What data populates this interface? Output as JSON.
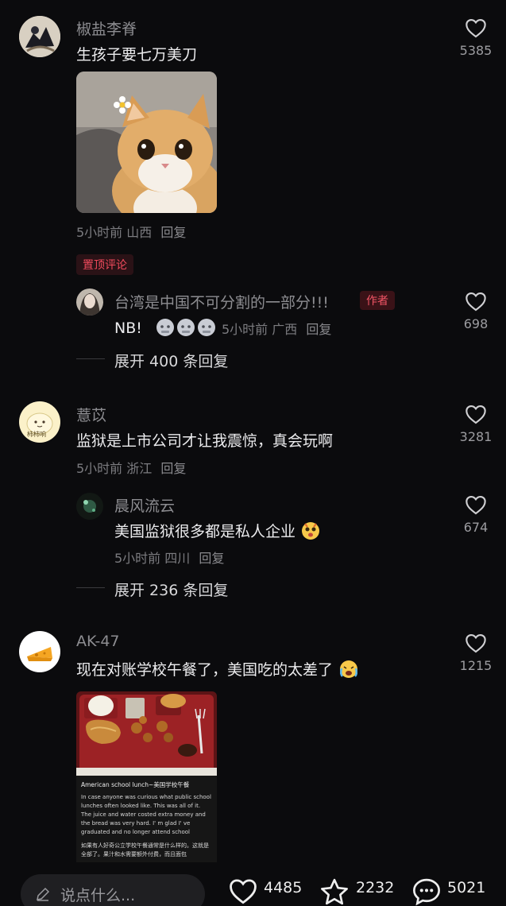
{
  "comments": [
    {
      "username": "椒盐李脊",
      "text": "生孩子要七万美刀",
      "time": "5小时前",
      "region": "山西",
      "reply_label": "回复",
      "likes": "5385"
    },
    {
      "username": "薏苡",
      "avatar_text": "柿柿响",
      "text": "监狱是上市公司才让我震惊，真会玩啊",
      "time": "5小时前",
      "region": "浙江",
      "reply_label": "回复",
      "likes": "3281"
    },
    {
      "username": "AK-47",
      "text": "现在对账学校午餐了，美国吃的太差了",
      "likes": "1215",
      "image": {
        "title": "American school lunch~美国学校午餐",
        "en_text": "In case anyone was curious what public school lunches often looked like. This was all of it. The juice and water costed extra money and the bread was very hard. I' m glad I' ve graduated and no longer attend school",
        "zh_text": "如果有人好奇公立学校午餐通常是什么样的。这就是全部了。果汁和水需要额外付费，而且面包"
      }
    }
  ],
  "pinned": {
    "tag": "置顶评论",
    "username": "台湾是中国不可分割的一部分!!!",
    "author_tag": "作者",
    "text": "NB!",
    "time": "5小时前",
    "region": "广西",
    "reply_label": "回复",
    "likes": "698",
    "expand": "展开 400 条回复"
  },
  "reply2": {
    "username": "晨风流云",
    "text": "美国监狱很多都是私人企业",
    "time": "5小时前",
    "region": "四川",
    "reply_label": "回复",
    "likes": "674",
    "expand": "展开 236 条回复"
  },
  "bottom": {
    "placeholder": "说点什么...",
    "likes": "4485",
    "favorites": "2232",
    "comments": "5021"
  },
  "colors": {
    "background": "#0b0b0d",
    "pin_red": "#f04a5c",
    "muted": "#7c7c80"
  }
}
